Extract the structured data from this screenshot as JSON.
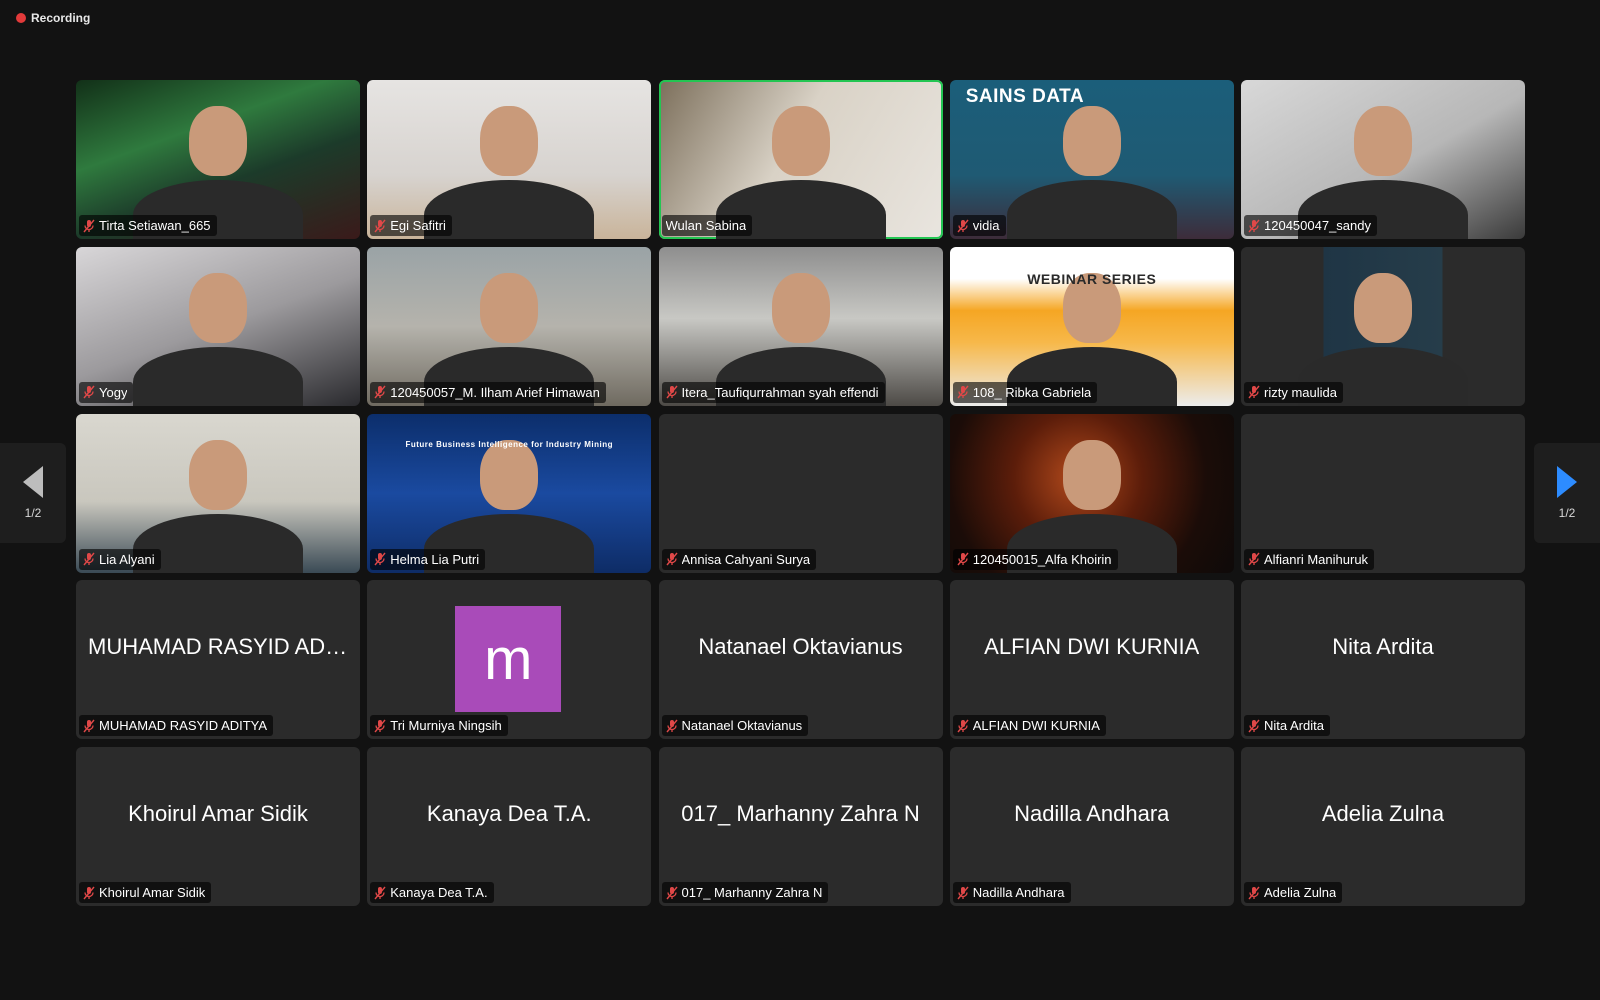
{
  "recording": {
    "label": "Recording",
    "dot_color": "#e23a3a"
  },
  "pagination": {
    "left_label": "1/2",
    "right_label": "1/2"
  },
  "active_speaker_color": "#23c552",
  "tiles": [
    {
      "name": "Tirta Setiawan_665",
      "muted": true,
      "kind": "video"
    },
    {
      "name": "Egi Safitri",
      "muted": true,
      "kind": "video"
    },
    {
      "name": "Wulan Sabina",
      "muted": false,
      "kind": "video",
      "active": true
    },
    {
      "name": "vidia",
      "muted": true,
      "kind": "video",
      "overlay": "SAINS DATA"
    },
    {
      "name": "120450047_sandy",
      "muted": true,
      "kind": "video"
    },
    {
      "name": "Yogy",
      "muted": true,
      "kind": "video"
    },
    {
      "name": "120450057_M. Ilham Arief Himawan",
      "muted": true,
      "kind": "video"
    },
    {
      "name": "Itera_Taufiqurrahman syah effendi",
      "muted": true,
      "kind": "video"
    },
    {
      "name": "108_ Ribka Gabriela",
      "muted": true,
      "kind": "video",
      "overlay": "WEBINAR SERIES"
    },
    {
      "name": "rizty maulida",
      "muted": true,
      "kind": "video"
    },
    {
      "name": "Lia Alyani",
      "muted": true,
      "kind": "video"
    },
    {
      "name": "Helma Lia Putri",
      "muted": true,
      "kind": "video",
      "overlay": "Future Business Intelligence for Industry Mining"
    },
    {
      "name": "Annisa Cahyani Surya",
      "muted": true,
      "kind": "blank"
    },
    {
      "name": "120450015_Alfa Khoirin",
      "muted": true,
      "kind": "video"
    },
    {
      "name": "Alfianri Manihuruk",
      "muted": true,
      "kind": "blank"
    },
    {
      "name": "MUHAMAD RASYID ADITYA",
      "display": "MUHAMAD RASYID ADI...",
      "muted": true,
      "kind": "text"
    },
    {
      "name": "Tri Murniya Ningsih",
      "muted": true,
      "kind": "avatar",
      "avatar_letter": "m",
      "avatar_color": "#a94bb9"
    },
    {
      "name": "Natanael Oktavianus",
      "display": "Natanael Oktavianus",
      "muted": true,
      "kind": "text"
    },
    {
      "name": "ALFIAN DWI KURNIA",
      "display": "ALFIAN DWI KURNIA",
      "muted": true,
      "kind": "text"
    },
    {
      "name": "Nita Ardita",
      "display": "Nita Ardita",
      "muted": true,
      "kind": "text"
    },
    {
      "name": "Khoirul Amar Sidik",
      "display": "Khoirul Amar Sidik",
      "muted": true,
      "kind": "text"
    },
    {
      "name": "Kanaya Dea T.A.",
      "display": "Kanaya Dea T.A.",
      "muted": true,
      "kind": "text"
    },
    {
      "name": "017_ Marhanny Zahra N",
      "display": "017_ Marhanny Zahra N",
      "muted": true,
      "kind": "text"
    },
    {
      "name": "Nadilla Andhara",
      "display": "Nadilla Andhara",
      "muted": true,
      "kind": "text"
    },
    {
      "name": "Adelia Zulna",
      "display": "Adelia Zulna",
      "muted": true,
      "kind": "text"
    }
  ],
  "icons": {
    "muted": "mic-muted-icon",
    "prev": "chevron-left-icon",
    "next": "chevron-right-icon"
  }
}
